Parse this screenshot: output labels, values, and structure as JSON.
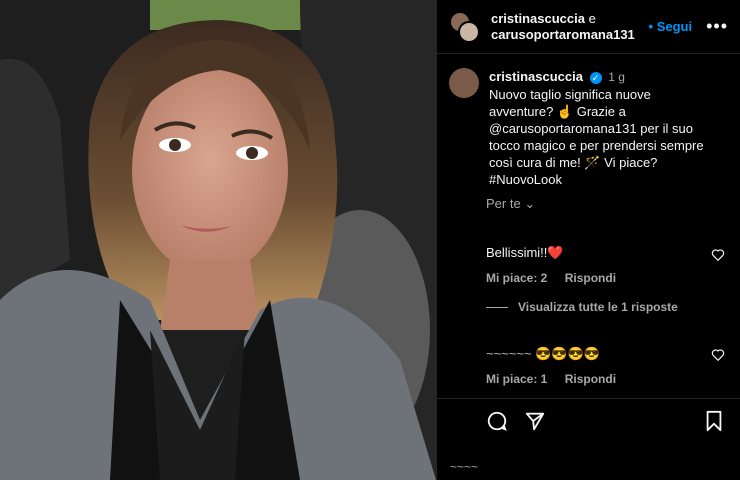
{
  "header": {
    "user1": "cristinascuccia",
    "join": " e ",
    "user2": "carusoportaromana131",
    "follow_label": "Segui",
    "more_label": "•••"
  },
  "caption": {
    "username": "cristinascuccia",
    "time": "1 g",
    "line1": "Nuovo taglio significa nuove",
    "line2": "avventure? ☝️ Grazie a",
    "line3": "@carusoportaromana131 per il suo",
    "line4": "tocco magico e per prendersi sempre",
    "line5": "così cura di me! 🪄 Vi piace?",
    "line6": "#NuovoLook"
  },
  "per_te": "Per te",
  "comments": [
    {
      "text": "Bellissimi!!❤️",
      "likes": "Mi piace: 2",
      "reply": "Rispondi"
    },
    {
      "text": "😎😎😎😎",
      "likes": "Mi piace: 1",
      "reply": "Rispondi"
    }
  ],
  "view_replies": "Visualizza tutte le 1 risposte",
  "colors": {
    "accent": "#0095f6",
    "bg": "#000000",
    "muted": "#a8a8a8"
  }
}
